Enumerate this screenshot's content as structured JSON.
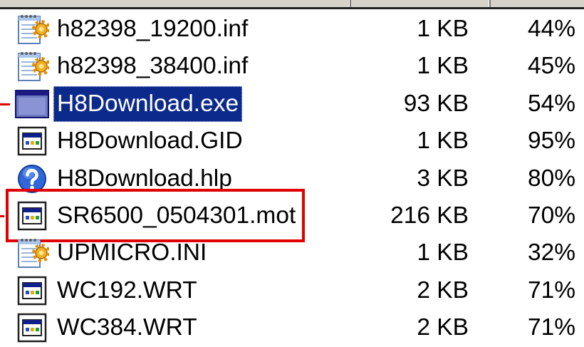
{
  "colors": {
    "background": "#ffffff",
    "selection": "#0c2a8c",
    "annotation": "#e00000",
    "text": "#000000"
  },
  "rows": [
    {
      "name": "h82398_19200.inf",
      "size": "1 KB",
      "ratio": "44%",
      "icon": "inf-file-icon",
      "selected": false,
      "boxed": false,
      "pointer": false
    },
    {
      "name": "h82398_38400.inf",
      "size": "1 KB",
      "ratio": "45%",
      "icon": "inf-file-icon",
      "selected": false,
      "boxed": false,
      "pointer": false
    },
    {
      "name": "H8Download.exe",
      "size": "93 KB",
      "ratio": "54%",
      "icon": "application-icon",
      "selected": true,
      "boxed": false,
      "pointer": true
    },
    {
      "name": "H8Download.GID",
      "size": "1 KB",
      "ratio": "95%",
      "icon": "window-file-icon",
      "selected": false,
      "boxed": false,
      "pointer": false
    },
    {
      "name": "H8Download.hlp",
      "size": "3 KB",
      "ratio": "80%",
      "icon": "help-file-icon",
      "selected": false,
      "boxed": false,
      "pointer": false
    },
    {
      "name": "SR6500_0504301.mot",
      "size": "216 KB",
      "ratio": "70%",
      "icon": "window-file-icon",
      "selected": false,
      "boxed": true,
      "pointer": true
    },
    {
      "name": "UPMICRO.INI",
      "size": "1 KB",
      "ratio": "32%",
      "icon": "inf-file-icon",
      "selected": false,
      "boxed": false,
      "pointer": false
    },
    {
      "name": "WC192.WRT",
      "size": "2 KB",
      "ratio": "71%",
      "icon": "window-file-icon",
      "selected": false,
      "boxed": false,
      "pointer": false
    },
    {
      "name": "WC384.WRT",
      "size": "2 KB",
      "ratio": "71%",
      "icon": "window-file-icon",
      "selected": false,
      "boxed": false,
      "pointer": false
    }
  ]
}
